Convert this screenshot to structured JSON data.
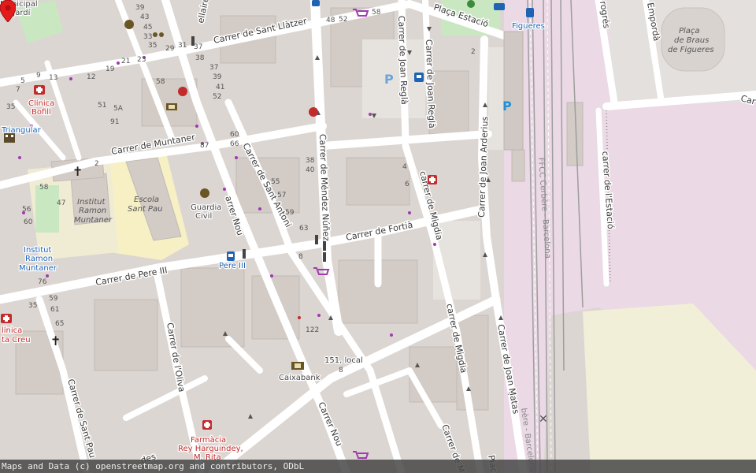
{
  "map": {
    "attribution": "Maps and Data (c) openstreetmap.org and contributors, ODbL",
    "colors": {
      "background": "#dcd6d2",
      "road": "#ffffff",
      "railway_area": "#ebd9e6",
      "school_area": "#f6f0c4",
      "park": "#c9e7c1",
      "marker": "#e31b1b"
    },
    "streets": {
      "sant_llatzer": "Carrer de Sant Llàtzer",
      "muntaner": "Carrer de Muntaner",
      "pere_iii": "Carrer de Pere III",
      "sant_antoni": "Carrer de Sant Antoni",
      "nou_top": "arrer Nou",
      "nou_bottom": "Carrer Nou",
      "mendez_nunez": "Carrer de Méndez Núñez",
      "fortia": "Carrer de Fortià",
      "joan_regla_a": "Carrer de Joan Reglà",
      "joan_regla_b": "Carrer de Joan Reglà",
      "migdia_a": "carrer de Migdia",
      "migdia_b": "carrer de Migdia",
      "migdia_c": "Carrer de M",
      "joan_arderius": "Carrer de Joan Arderius",
      "joan_matas": "Carrer de Joan Matas",
      "estacio_street": "carrer de l'Estació",
      "placa_estacio": "Plaça Estació",
      "oliva": "Carrer de l'Oliva",
      "sant_pau": "Carrer de Sant Pau",
      "emporda": "Empordà",
      "progres": "rogrés",
      "car_right": "Car",
      "rail_line": "FFCC Cerbère - Barcelona",
      "rail_line_bottom": "bère - Barcelona",
      "rellaire": "ellaire",
      "placa_bottom": "Plac",
      "ldes": "des"
    },
    "pois": {
      "municipal": "Municipal",
      "el_jardi": "El Jardí",
      "clinica_bofill_1": "Clínica",
      "clinica_bofill_2": "Bofill",
      "triangular": "Triangular",
      "institut_muntaner_1": "Institut",
      "institut_muntaner_2": "Ramon",
      "institut_muntaner_3": "Muntaner",
      "institut_blue_1": "Institut",
      "institut_blue_2": "Ramon",
      "institut_blue_3": "Muntaner",
      "escola_1": "Escola",
      "escola_2": "Sant Pau",
      "guardia_1": "Guardia",
      "guardia_2": "Civil",
      "pere_iii_stop": "Pere III",
      "figueres": "Figueres",
      "placa_braus_1": "Plaça",
      "placa_braus_2": "de Braus",
      "placa_braus_3": "de Figueres",
      "clinica_creu_1": "línica",
      "clinica_creu_2": "ta Creu",
      "caixabank": "Caixabank",
      "local": "151, local",
      "farmacia_1": "Farmàcia",
      "farmacia_2": "Rey Harguindey,",
      "farmacia_3": "M. Rita"
    },
    "house_numbers": [
      "39",
      "43",
      "45",
      "33",
      "35",
      "37",
      "29",
      "31",
      "38",
      "37",
      "39",
      "41",
      "52",
      "58",
      "60",
      "66",
      "87",
      "9",
      "13",
      "12",
      "19",
      "21",
      "23",
      "5",
      "7",
      "2",
      "35",
      "51",
      "5A",
      "91",
      "38",
      "40",
      "55",
      "57",
      "59",
      "63",
      "8",
      "56",
      "60",
      "58",
      "47",
      "59",
      "61",
      "65",
      "35",
      "76",
      "122",
      "48",
      "52",
      "58",
      "4",
      "6",
      "2",
      "8"
    ]
  }
}
